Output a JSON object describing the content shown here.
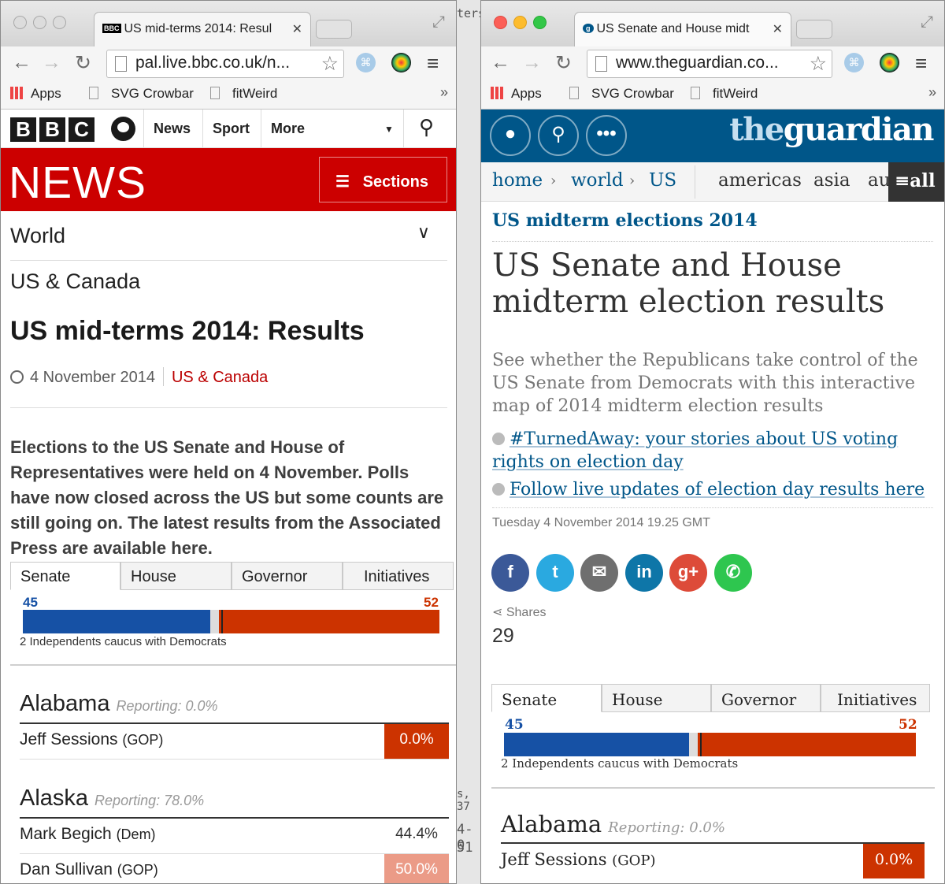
{
  "bbc_window": {
    "tab_title": "US mid-terms 2014: Resul",
    "tab_favicon": "BBC",
    "url": "pal.live.bbc.co.uk/n...",
    "bookmarks": [
      "Apps",
      "SVG Crowbar",
      "fitWeird"
    ],
    "bookmarks_more": "»",
    "header": {
      "logo": [
        "B",
        "B",
        "C"
      ],
      "nav": [
        "News",
        "Sport",
        "More"
      ]
    },
    "masthead": {
      "title": "NEWS",
      "sections_label": "Sections"
    },
    "section": "World",
    "category": "US & Canada",
    "headline": "US mid-terms 2014: Results",
    "date": "4 November 2014",
    "date_category": "US & Canada",
    "intro": "Elections to the US Senate and House of Representatives were held on 4 November. Polls have now closed across the US but some counts are still going on. The latest results from the Associated Press are available here.",
    "results": {
      "tabs": [
        "Senate",
        "House",
        "Governor",
        "Initiatives"
      ],
      "dem_seats": "45",
      "gop_seats": "52",
      "dem_fraction": 0.45,
      "independent_fraction": 0.02,
      "gop_fraction": 0.52,
      "note": "2 Independents caucus with Democrats",
      "states": [
        {
          "name": "Alabama",
          "reporting": "Reporting: 0.0%",
          "candidates": [
            {
              "name": "Jeff Sessions",
              "party": "(GOP)",
              "pct": "0.0%",
              "style": "gop"
            }
          ]
        },
        {
          "name": "Alaska",
          "reporting": "Reporting: 78.0%",
          "candidates": [
            {
              "name": "Mark Begich",
              "party": "(Dem)",
              "pct": "44.4%",
              "style": "plain"
            },
            {
              "name": "Dan Sullivan",
              "party": "(GOP)",
              "pct": "50.0%",
              "style": "gop-light"
            }
          ]
        }
      ]
    }
  },
  "guardian_window": {
    "tab_title": "US Senate and House midt",
    "url": "www.theguardian.co...",
    "bookmarks": [
      "Apps",
      "SVG Crowbar",
      "fitWeird"
    ],
    "bookmarks_more": "»",
    "logo_the": "the",
    "logo_rest": "guardian",
    "nav": {
      "breadcrumb": [
        "home",
        "world",
        "US"
      ],
      "regions": [
        "americas",
        "asia",
        "au"
      ],
      "all_label": "all"
    },
    "series": "US midterm elections 2014",
    "headline": "US Senate and House midterm election results",
    "standfirst": "See whether the Republicans take control of the US Senate from Democrats with this interactive map of 2014 midterm election results",
    "links": [
      "#TurnedAway: your stories about US voting rights on election day",
      "Follow live updates of election day results here"
    ],
    "dateline": "Tuesday 4 November 2014 19.25 GMT",
    "share_buttons": [
      "facebook-icon",
      "twitter-icon",
      "email-icon",
      "linkedin-icon",
      "google-plus-icon",
      "whatsapp-icon"
    ],
    "share_glyphs": [
      "f",
      "t",
      "✉",
      "in",
      "g+",
      "✆"
    ],
    "shares_label": "Shares",
    "shares_count": "29",
    "results": {
      "tabs": [
        "Senate",
        "House",
        "Governor",
        "Initiatives"
      ],
      "dem_seats": "45",
      "gop_seats": "52",
      "dem_fraction": 0.45,
      "independent_fraction": 0.02,
      "gop_fraction": 0.52,
      "note": "2 Independents caucus with Democrats",
      "states": [
        {
          "name": "Alabama",
          "reporting": "Reporting: 0.0%",
          "candidates": [
            {
              "name": "Jeff Sessions",
              "party": "(GOP)",
              "pct": "0.0%",
              "style": "gop"
            }
          ]
        }
      ]
    }
  },
  "background_window": {
    "visible_fragments": [
      "ters",
      "s, 37",
      "4-0",
      "51"
    ]
  },
  "colors": {
    "bbc_red": "#cc0000",
    "guardian_blue": "#005689",
    "dem_blue": "#1651a5",
    "gop_red": "#cc3300"
  }
}
